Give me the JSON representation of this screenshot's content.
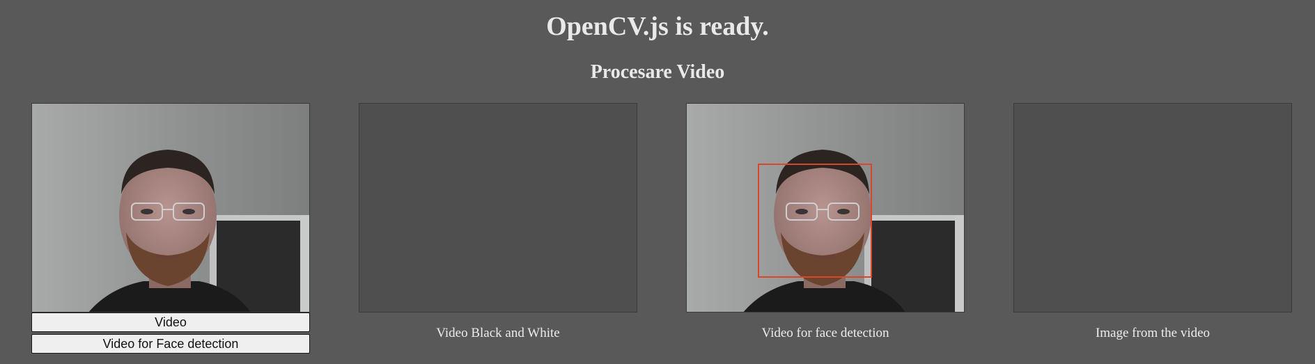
{
  "header": {
    "status": "OpenCV.js is ready.",
    "section_title": "Procesare Video"
  },
  "panels": [
    {
      "kind": "webcam-video"
    },
    {
      "kind": "canvas",
      "caption": "Video Black and White"
    },
    {
      "kind": "canvas-face-detection",
      "caption": "Video for face detection"
    },
    {
      "kind": "canvas",
      "caption": "Image from the video"
    }
  ],
  "buttons": {
    "video_label": "Video",
    "face_detection_label": "Video for Face detection"
  },
  "colors": {
    "page_background": "#595959",
    "detection_box": "#d9472b"
  }
}
